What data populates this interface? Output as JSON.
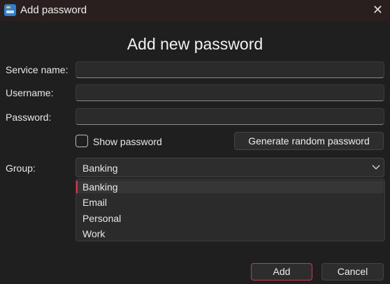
{
  "window": {
    "title": "Add password"
  },
  "heading": "Add new password",
  "fields": {
    "service_label": "Service name:",
    "service_value": "",
    "username_label": "Username:",
    "username_value": "",
    "password_label": "Password:",
    "password_value": ""
  },
  "show_password": {
    "label": "Show password",
    "checked": false
  },
  "generate_label": "Generate random password",
  "group": {
    "label": "Group:",
    "selected": "Banking",
    "options": [
      "Banking",
      "Email",
      "Personal",
      "Work"
    ]
  },
  "buttons": {
    "add": "Add",
    "cancel": "Cancel"
  },
  "colors": {
    "accent": "#e0334a"
  }
}
